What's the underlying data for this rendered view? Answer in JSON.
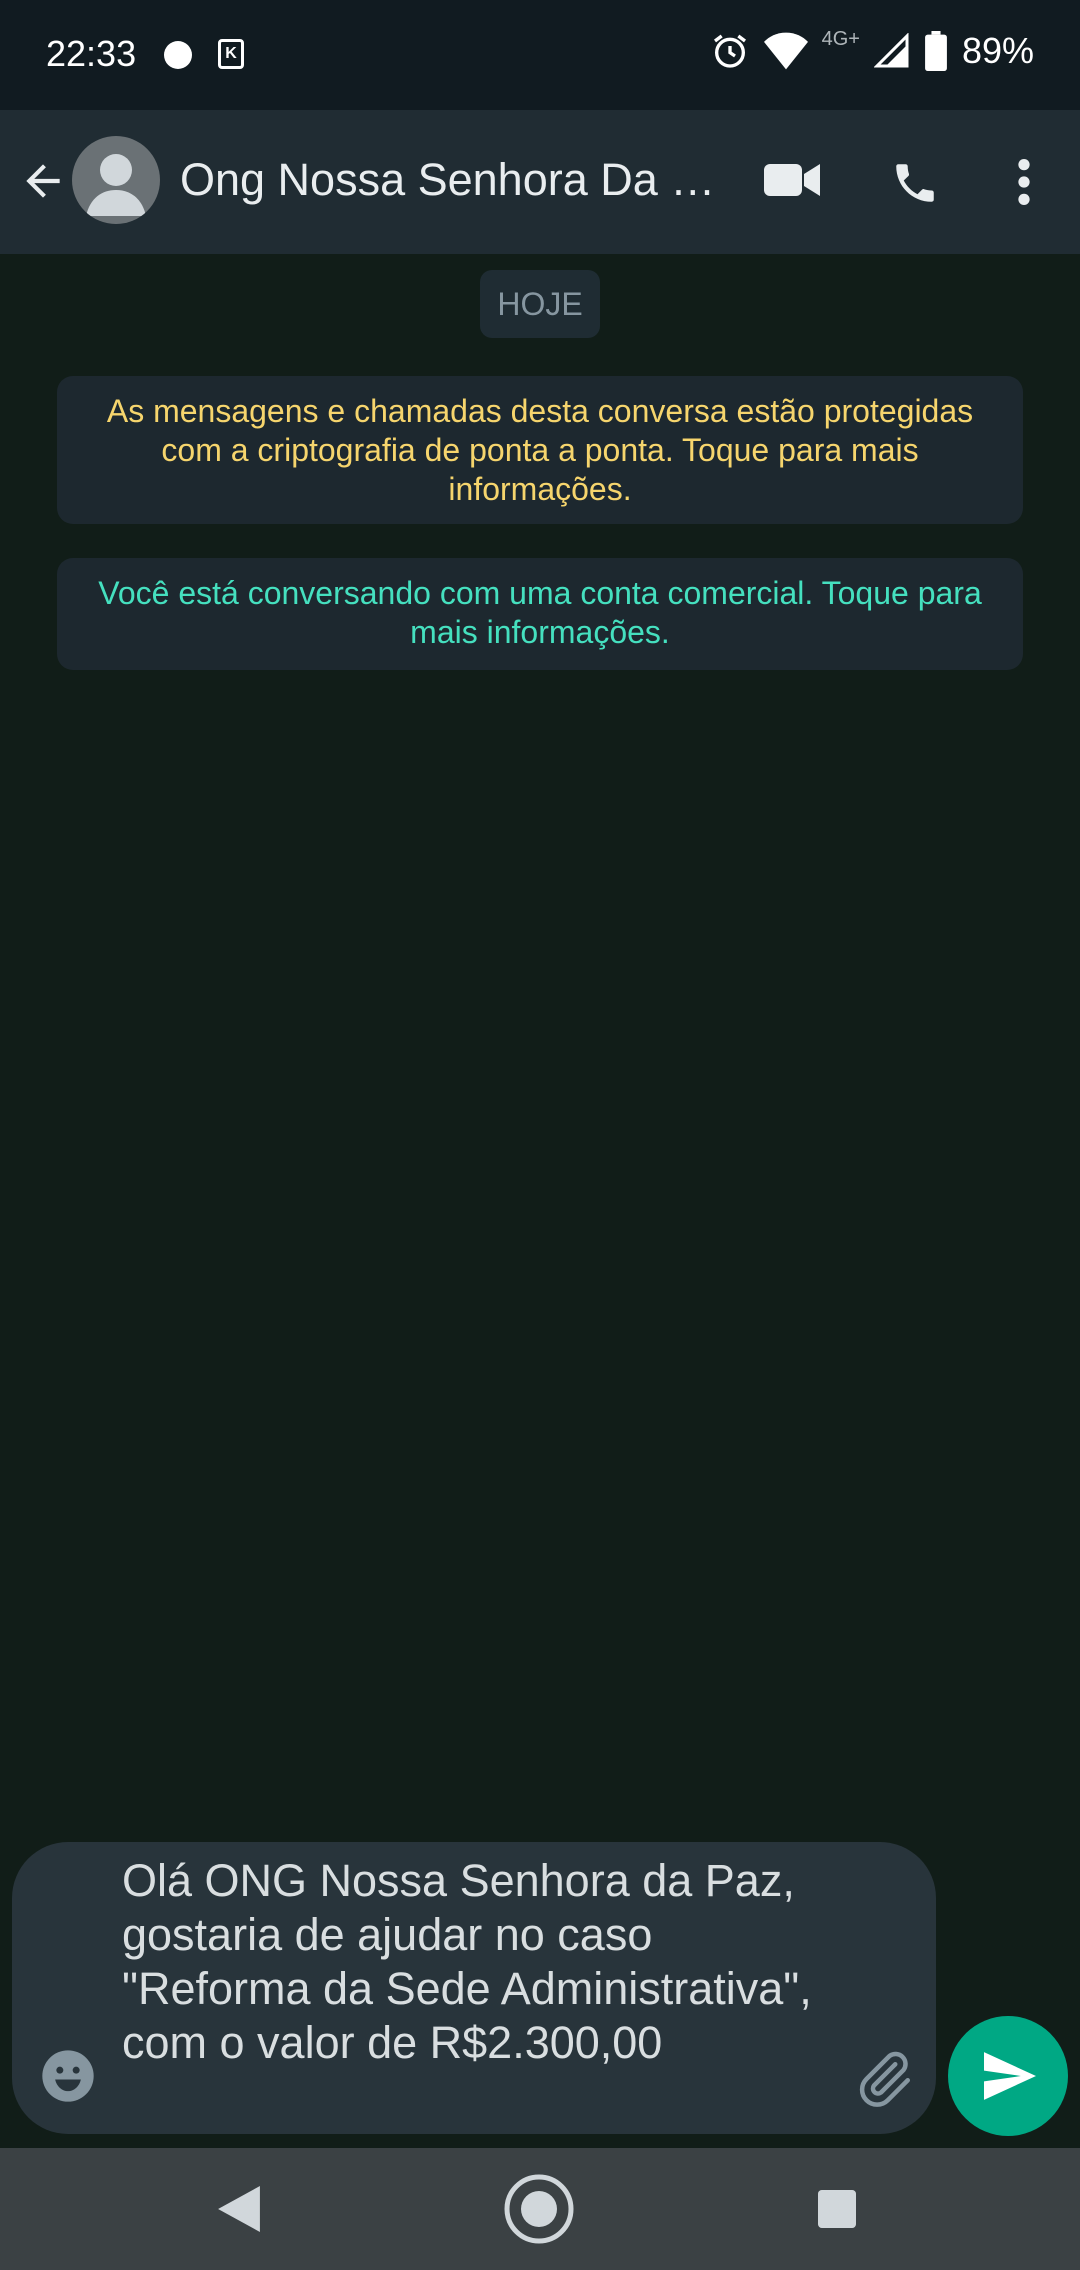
{
  "status_bar": {
    "time": "22:33",
    "network": "4G+",
    "battery": "89%"
  },
  "header": {
    "contact_name": "Ong Nossa Senhora Da P..."
  },
  "chat": {
    "date_chip": "HOJE",
    "encryption_notice": "As mensagens e chamadas desta conversa estão protegidas com a criptografia de ponta a ponta. Toque para mais informações.",
    "business_notice": "Você está conversando com uma conta comercial. Toque para mais informações."
  },
  "composer": {
    "text": "Olá ONG Nossa Senhora da Paz, gostaria de ajudar no caso \"Reforma da Sede Administrativa\", com o valor de R$2.300,00"
  },
  "colors": {
    "accent": "#00a884",
    "encryption_text": "#f6d56d",
    "business_text": "#45e0bf",
    "background": "#111d18"
  },
  "icons": {
    "status": [
      "notification-dot-icon",
      "k-app-icon",
      "alarm-icon",
      "wifi-icon",
      "signal-icon",
      "battery-icon"
    ],
    "header": [
      "back-arrow-icon",
      "video-call-icon",
      "phone-icon",
      "more-vert-icon"
    ],
    "composer": [
      "emoji-icon",
      "attach-icon",
      "send-icon"
    ],
    "nav": [
      "nav-back-icon",
      "nav-home-icon",
      "nav-recents-icon"
    ]
  }
}
